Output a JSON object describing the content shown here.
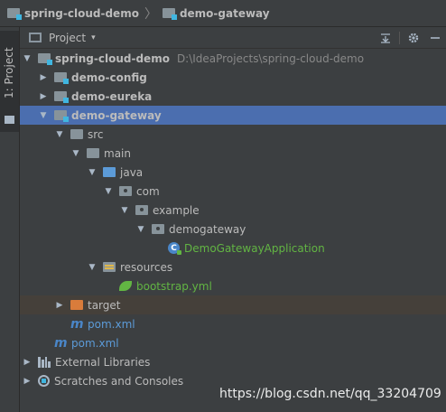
{
  "breadcrumb": {
    "root": "spring-cloud-demo",
    "sep": "〉",
    "child": "demo-gateway"
  },
  "sidebar": {
    "tab_label": "1: Project"
  },
  "panel": {
    "title": "Project",
    "caret": "▾"
  },
  "tree": {
    "root": {
      "label": "spring-cloud-demo",
      "path": "D:\\IdeaProjects\\spring-cloud-demo"
    },
    "demo_config": "demo-config",
    "demo_eureka": "demo-eureka",
    "demo_gateway": "demo-gateway",
    "src": "src",
    "main": "main",
    "java": "java",
    "com": "com",
    "example": "example",
    "demogateway": "demogateway",
    "app_class": "DemoGatewayApplication",
    "resources": "resources",
    "bootstrap": "bootstrap.yml",
    "target": "target",
    "gateway_pom": "pom.xml",
    "root_pom": "pom.xml",
    "external_libs": "External Libraries",
    "scratches": "Scratches and Consoles"
  },
  "watermark": "https://blog.csdn.net/qq_33204709",
  "colors": {
    "selection": "#4b6eaf",
    "excluded_row": "#45403a",
    "resource_green": "#62b543",
    "maven_blue": "#5c9bd8"
  }
}
